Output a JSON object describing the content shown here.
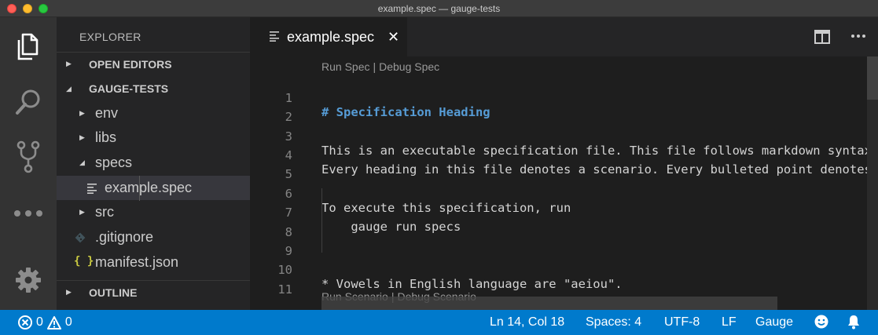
{
  "window": {
    "title": "example.spec — gauge-tests"
  },
  "activity_bar": {
    "items": [
      {
        "name": "explorer",
        "icon": "files-icon",
        "active": true
      },
      {
        "name": "search",
        "icon": "search-icon"
      },
      {
        "name": "source-control",
        "icon": "source-control-icon"
      },
      {
        "name": "extensions",
        "icon": "more-icon"
      },
      {
        "name": "manage",
        "icon": "gear-icon"
      }
    ]
  },
  "sidebar": {
    "title": "EXPLORER",
    "sections": {
      "open_editors": "OPEN EDITORS",
      "project": "GAUGE-TESTS",
      "outline": "OUTLINE"
    },
    "tree": [
      {
        "label": "env",
        "type": "folder",
        "expanded": false
      },
      {
        "label": "libs",
        "type": "folder",
        "expanded": false
      },
      {
        "label": "specs",
        "type": "folder",
        "expanded": true
      },
      {
        "label": "example.spec",
        "type": "file",
        "selected": true
      },
      {
        "label": "src",
        "type": "folder",
        "expanded": false
      },
      {
        "label": ".gitignore",
        "type": "file"
      },
      {
        "label": "manifest.json",
        "type": "file",
        "icon_text": "{ }"
      }
    ]
  },
  "editor": {
    "tab": {
      "label": "example.spec",
      "close": "✕"
    },
    "codelens_top": {
      "run": "Run Spec",
      "sep": "|",
      "debug": "Debug Spec"
    },
    "codelens_bottom": {
      "run": "Run Scenario",
      "sep": "|",
      "debug": "Debug Scenario"
    },
    "lines": [
      {
        "n": "1",
        "text": "# Specification Heading",
        "kind": "heading"
      },
      {
        "n": "2",
        "text": ""
      },
      {
        "n": "3",
        "text": "This is an executable specification file. This file follows markdown syntax."
      },
      {
        "n": "4",
        "text": "Every heading in this file denotes a scenario. Every bulleted point denotes a step."
      },
      {
        "n": "5",
        "text": ""
      },
      {
        "n": "6",
        "text": "To execute this specification, run"
      },
      {
        "n": "7",
        "text": "    gauge run specs"
      },
      {
        "n": "8",
        "text": ""
      },
      {
        "n": "9",
        "text": ""
      },
      {
        "n": "10",
        "text": "* Vowels in English language are \"aeiou\"."
      },
      {
        "n": "11",
        "text": ""
      }
    ]
  },
  "status_bar": {
    "errors": "0",
    "warnings": "0",
    "position": "Ln 14, Col 18",
    "indent": "Spaces: 4",
    "encoding": "UTF-8",
    "eol": "LF",
    "language": "Gauge"
  }
}
